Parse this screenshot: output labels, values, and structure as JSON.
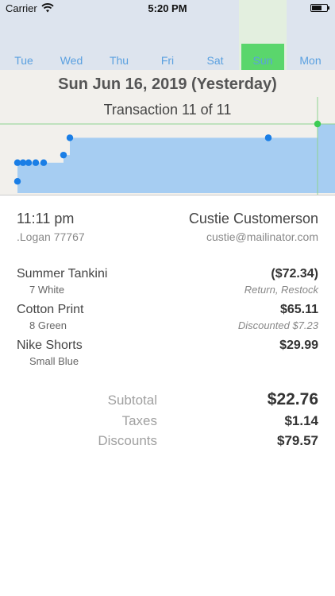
{
  "status_bar": {
    "carrier": "Carrier",
    "time": "5:20 PM"
  },
  "week": {
    "days": [
      {
        "label": "Tue",
        "level": 0
      },
      {
        "label": "Wed",
        "level": 0
      },
      {
        "label": "Thu",
        "level": 0
      },
      {
        "label": "Fri",
        "level": 0
      },
      {
        "label": "Sat",
        "level": 0
      },
      {
        "label": "Sun",
        "level": 0.37,
        "selected": true
      },
      {
        "label": "Mon",
        "level": 0
      }
    ]
  },
  "detail": {
    "date": "Sun Jun 16, 2019 (Yesterday)",
    "transaction": "Transaction 11 of 11"
  },
  "chart_data": {
    "type": "area",
    "description_points": "cumulative daily sales; each dot is one transaction",
    "x": [
      0.5,
      1,
      1.5,
      2,
      2.5,
      3,
      3.5,
      4,
      4.5,
      5,
      5.5
    ],
    "y": [
      0.12,
      0.44,
      0.44,
      0.44,
      0.44,
      0.44,
      0.55,
      0.8,
      0.8,
      0.8,
      0.8
    ],
    "markers_y": [
      0.17,
      0.44,
      0.44,
      0.44,
      0.44,
      0.44,
      0.55,
      0.8,
      0.8,
      0.8,
      1.0
    ],
    "colors": {
      "fill": "#a6cdf2",
      "marker": "#1a7ee6",
      "current": "#3ccc55",
      "line": "#8fd48f"
    }
  },
  "customer": {
    "time": "11:11 pm",
    "location": ".Logan 77767",
    "name": "Custie Customerson",
    "email": "custie@mailinator.com"
  },
  "items": [
    {
      "name": "Summer Tankini",
      "variant": "7 White",
      "price": "($72.34)",
      "note": "Return, Restock"
    },
    {
      "name": "Cotton Print",
      "variant": "8 Green",
      "price": "$65.11",
      "note": "Discounted $7.23"
    },
    {
      "name": "Nike Shorts",
      "variant": "Small Blue",
      "price": "$29.99",
      "note": ""
    }
  ],
  "summary": {
    "subtotal_label": "Subtotal",
    "subtotal": "$22.76",
    "taxes_label": "Taxes",
    "taxes": "$1.14",
    "discounts_label": "Discounts",
    "discounts": "$79.57"
  }
}
